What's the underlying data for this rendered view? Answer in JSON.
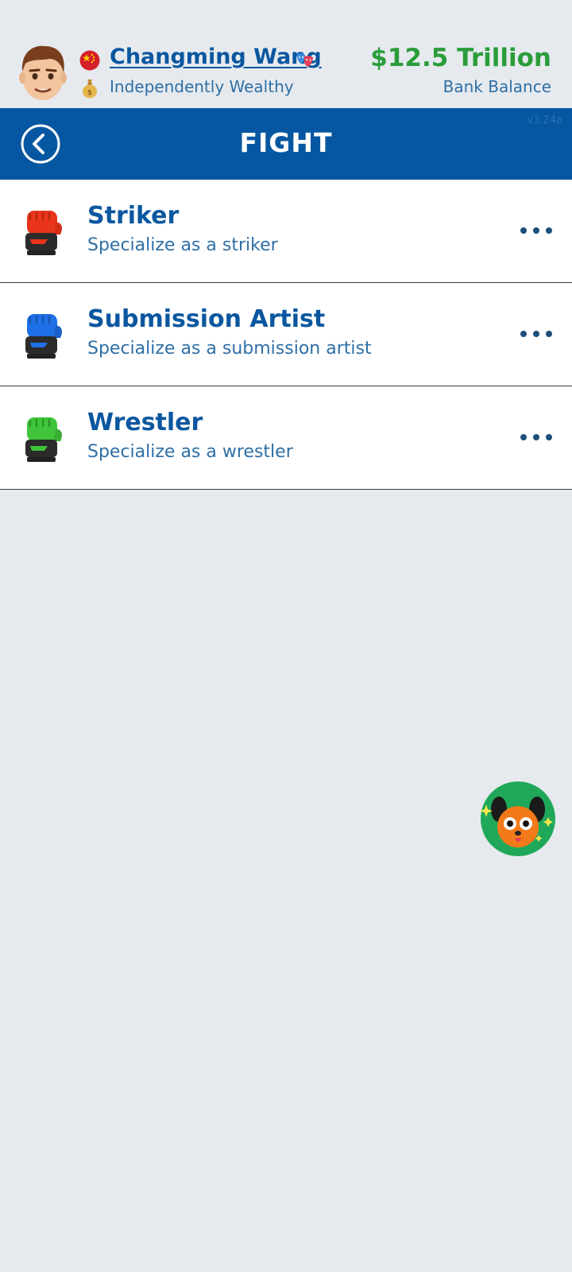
{
  "header": {
    "player_name": "Changming Wang",
    "status": "Independently Wealthy",
    "balance": "$12.5 Trillion",
    "balance_label": "Bank Balance",
    "flag_icon": "china-flag-icon",
    "status_icon": "money-bag-icon",
    "masks_icon": "theater-masks-icon"
  },
  "navbar": {
    "title": "FIGHT",
    "version": "v3.24a",
    "back_icon": "chevron-left-icon"
  },
  "items": [
    {
      "title": "Striker",
      "subtitle": "Specialize as a striker",
      "icon": "red-glove-icon",
      "color": "#e8351c"
    },
    {
      "title": "Submission Artist",
      "subtitle": "Specialize as a submission artist",
      "icon": "blue-glove-icon",
      "color": "#1f6fe6"
    },
    {
      "title": "Wrestler",
      "subtitle": "Specialize as a wrestler",
      "icon": "green-glove-icon",
      "color": "#3fc43a"
    }
  ],
  "colors": {
    "navbar": "#0557a1",
    "balance": "#2a9d3a",
    "primary_text": "#0a57a0",
    "background": "#e6eaee"
  },
  "floating_button": {
    "icon": "dog-mascot-icon"
  }
}
